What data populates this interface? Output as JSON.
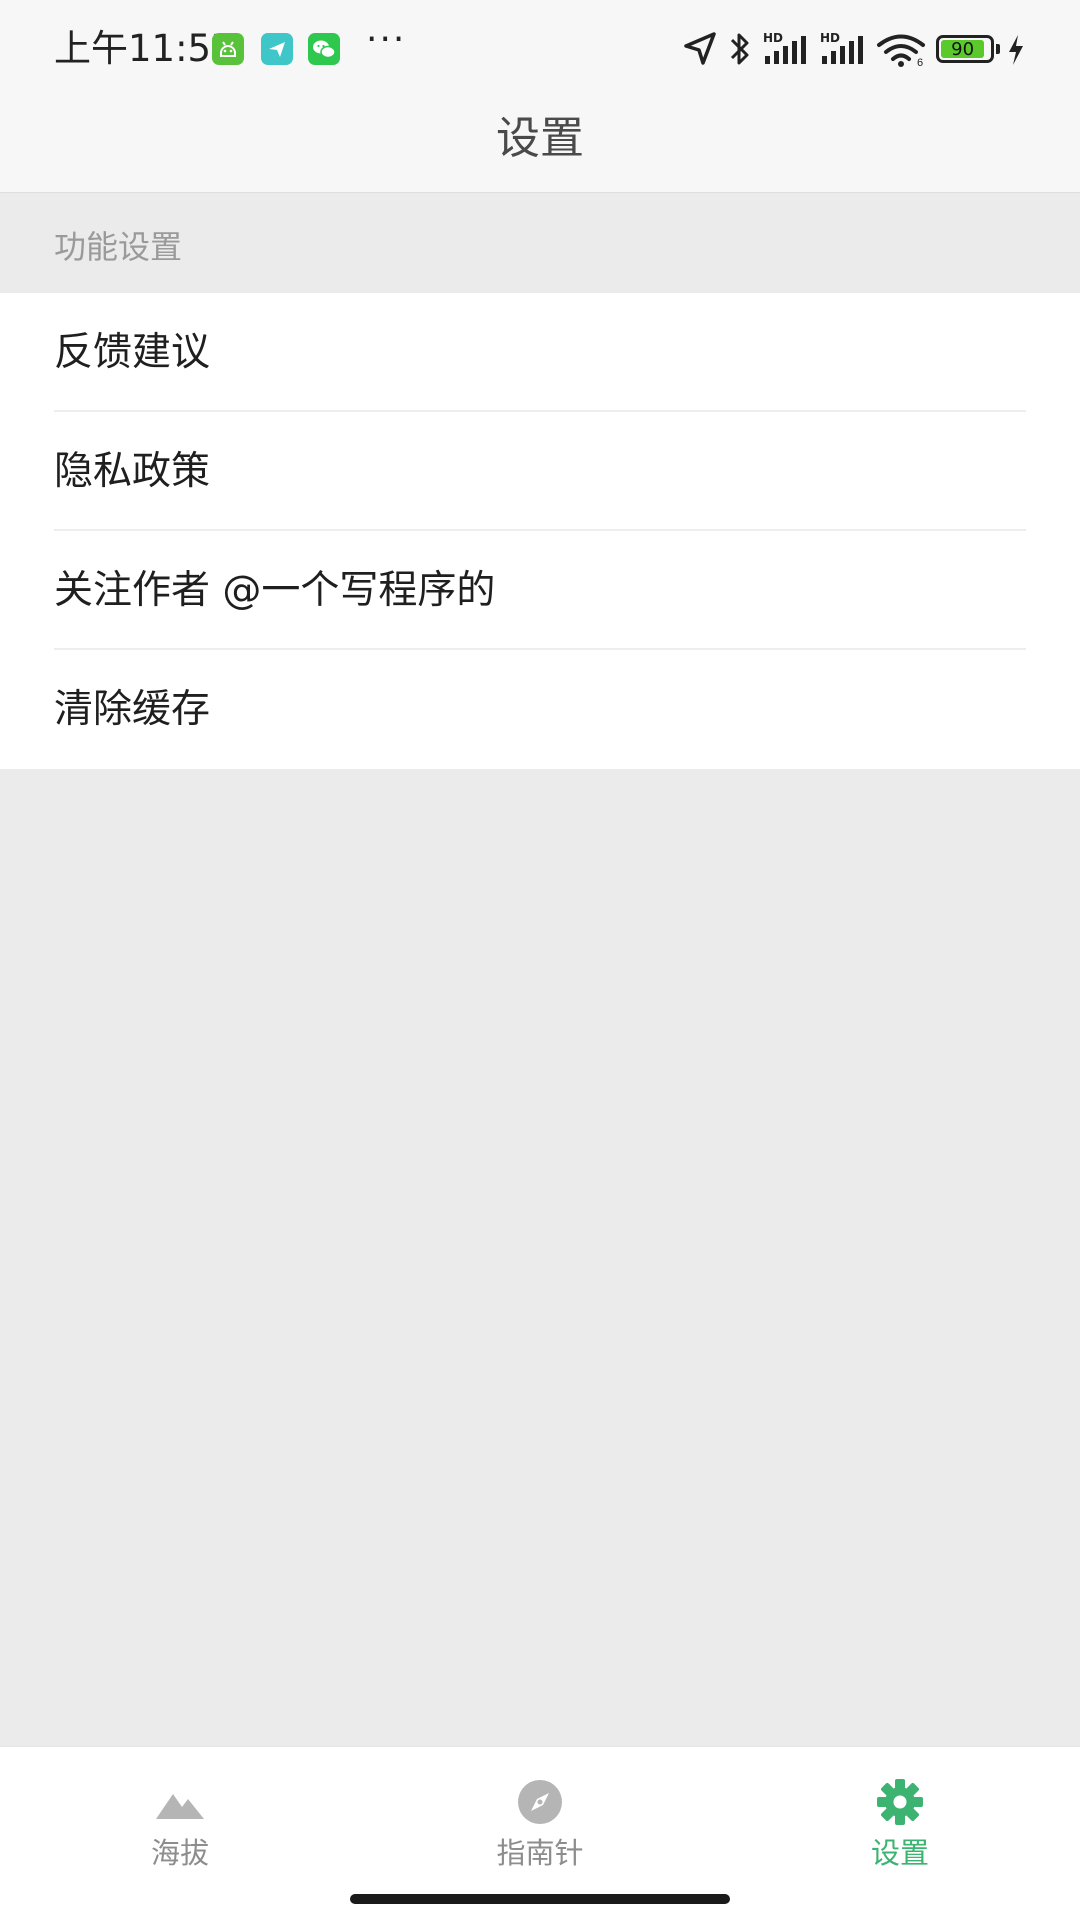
{
  "status_bar": {
    "time": "上午11:57",
    "notification_icons": [
      "android-robot-icon",
      "send-arrow-icon",
      "wechat-icon"
    ],
    "more": "···",
    "hd_label_1": "HD",
    "hd_label_2": "HD",
    "battery_level": 90,
    "battery_text": "90",
    "charging": true,
    "colors": {
      "battery_green": "#5ac92b",
      "android_green": "#58c23a",
      "send_teal": "#3ec6c8",
      "wechat_green": "#2dc84d"
    }
  },
  "nav": {
    "title": "设置"
  },
  "section": {
    "header": "功能设置"
  },
  "settings": {
    "items": [
      {
        "label": "反馈建议"
      },
      {
        "label": "隐私政策"
      },
      {
        "label": "关注作者 @一个写程序的"
      },
      {
        "label": "清除缓存"
      }
    ]
  },
  "tabbar": {
    "active_color": "#3cb371",
    "inactive_color": "#8d8d8d",
    "tabs": [
      {
        "label": "海拔",
        "icon": "mountain-icon",
        "active": false
      },
      {
        "label": "指南针",
        "icon": "compass-icon",
        "active": false
      },
      {
        "label": "设置",
        "icon": "gear-icon",
        "active": true
      }
    ]
  }
}
